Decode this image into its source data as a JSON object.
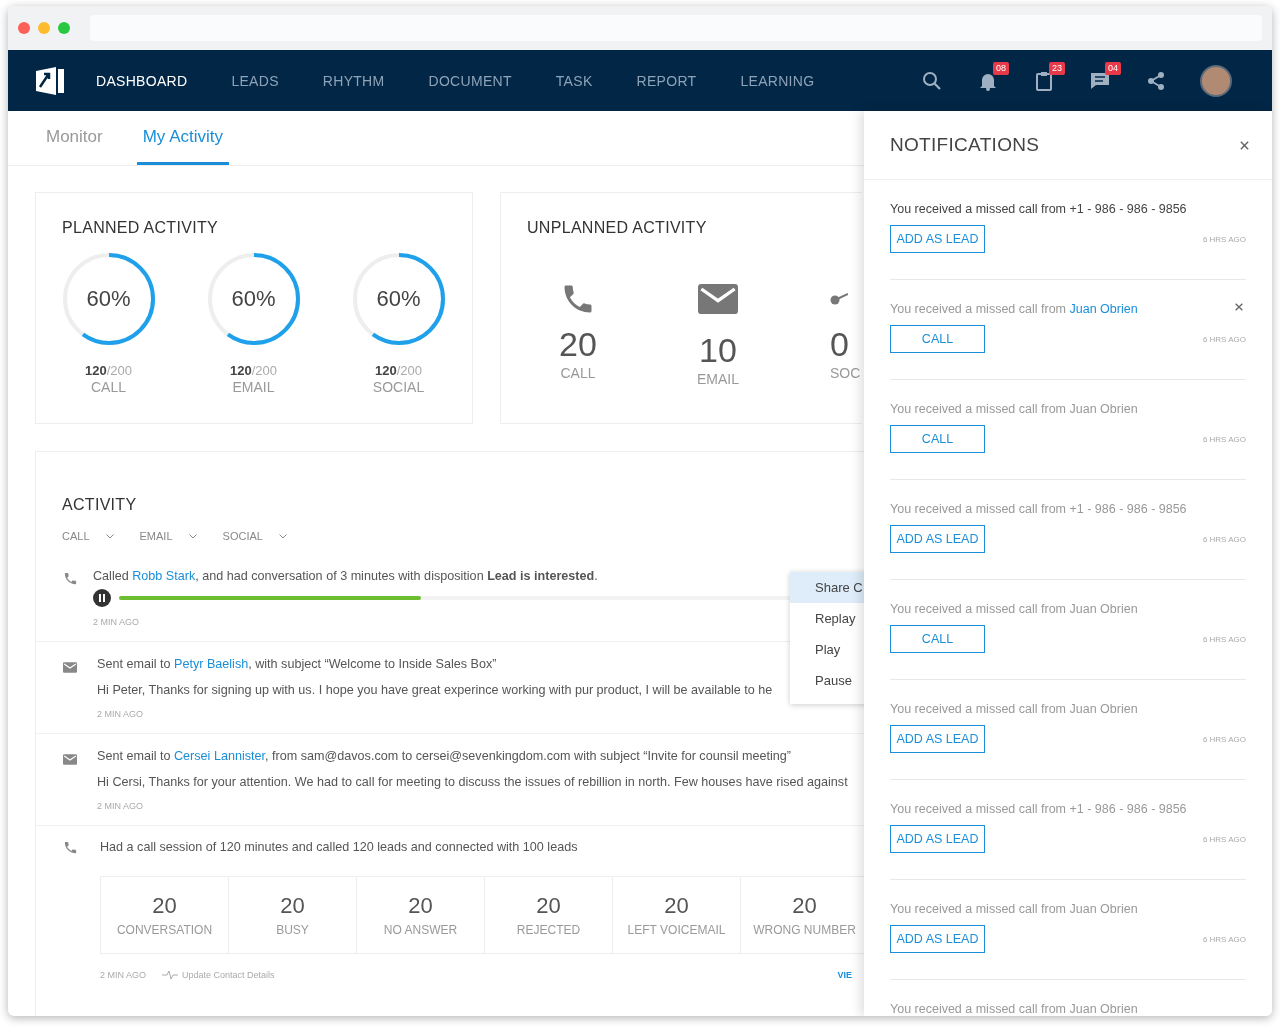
{
  "nav": {
    "items": [
      {
        "label": "DASHBOARD",
        "selected": true
      },
      {
        "label": "LEADS",
        "selected": false
      },
      {
        "label": "RHYTHM",
        "selected": false
      },
      {
        "label": "DOCUMENT",
        "selected": false
      },
      {
        "label": "TASK",
        "selected": false
      },
      {
        "label": "REPORT",
        "selected": false
      },
      {
        "label": "LEARNING",
        "selected": false
      }
    ],
    "icons": [
      {
        "kind": "search"
      },
      {
        "kind": "bell",
        "badge": "08"
      },
      {
        "kind": "clipboard",
        "badge": "23"
      },
      {
        "kind": "chat",
        "badge": "04"
      },
      {
        "kind": "share"
      },
      {
        "kind": "avatar"
      }
    ]
  },
  "tabs": [
    {
      "label": "Monitor",
      "selected": false
    },
    {
      "label": "My Activity",
      "selected": true
    }
  ],
  "planned": {
    "title": "PLANNED ACTIVITY",
    "items": [
      {
        "percent": "60%",
        "level": 0.6,
        "done": "120",
        "total": "/200",
        "label": "CALL"
      },
      {
        "percent": "60%",
        "level": 0.6,
        "done": "120",
        "total": "/200",
        "label": "EMAIL"
      },
      {
        "percent": "60%",
        "level": 0.6,
        "done": "120",
        "total": "/200",
        "label": "SOCIAL"
      }
    ]
  },
  "unplanned": {
    "title": "UNPLANNED ACTIVITY",
    "items": [
      {
        "kind": "phone",
        "count": "20",
        "label": "CALL"
      },
      {
        "kind": "email",
        "count": "10",
        "label": "EMAIL"
      },
      {
        "kind": "social",
        "count": "0",
        "label": "SOC"
      }
    ]
  },
  "activity": {
    "title": "ACTIVITY",
    "filters": [
      "CALL",
      "EMAIL",
      "SOCIAL"
    ],
    "rows": [
      {
        "kind": "call",
        "before": "Called ",
        "link": "Robb Stark",
        "after": ", and had conversation of 3 minutes with disposition **Lead is interested**.",
        "player": {
          "level": 0.45
        },
        "time": "2 MIN AGO"
      },
      {
        "kind": "email",
        "before": "Sent email to ",
        "link": "Petyr Baelish",
        "after": ", with subject “Welcome to Inside Sales Box”",
        "body": "Hi Peter, Thanks for signing up with us. I hope you have great experince working with pur product, I will be available to he",
        "time": "2 MIN AGO"
      },
      {
        "kind": "email",
        "before": "Sent email to ",
        "link": "Cersei Lannister",
        "after": ", from sam@davos.com to cersei@sevenkingdom.com with subject “Invite for counsil meeting”",
        "body": "Hi Cersi, Thanks for your attention. We had to call for meeting to discuss the issues of rebillion in north. Few houses have rised against",
        "time": "2 MIN AGO"
      },
      {
        "kind": "session",
        "text": "Had a call session of 120 minutes and called 120 leads and connected with 100 leads",
        "stats": [
          {
            "value": "20",
            "label": "CONVERSATION"
          },
          {
            "value": "20",
            "label": "BUSY"
          },
          {
            "value": "20",
            "label": "NO ANSWER"
          },
          {
            "value": "20",
            "label": "REJECTED"
          },
          {
            "value": "20",
            "label": "LEFT VOICEMAIL"
          },
          {
            "value": "20",
            "label": "WRONG NUMBER"
          }
        ],
        "time": "2 MIN AGO",
        "action": "Update Contact Details",
        "link_label": "VIE"
      }
    ],
    "menu": [
      {
        "label": "Share C",
        "selected": true
      },
      {
        "label": "Replay",
        "selected": false
      },
      {
        "label": "Play",
        "selected": false
      },
      {
        "label": "Pause",
        "selected": false
      }
    ]
  },
  "notifications": {
    "title": "NOTIFICATIONS",
    "items": [
      {
        "unread": true,
        "text": "You received a missed call from +1 - 986 - 986 - 9856",
        "button": "ADD AS LEAD",
        "time": "6 HRS AGO",
        "closable": false
      },
      {
        "unread": false,
        "text": "You received a missed call from ",
        "link": "Juan Obrien",
        "button": "CALL",
        "time": "6 HRS AGO",
        "closable": true
      },
      {
        "unread": false,
        "text": "You received a missed call from Juan Obrien",
        "button": "CALL",
        "time": "6 HRS AGO",
        "closable": false
      },
      {
        "unread": false,
        "text": "You received a missed call from +1 - 986 - 986 - 9856",
        "button": "ADD AS LEAD",
        "time": "6 HRS AGO",
        "closable": false
      },
      {
        "unread": false,
        "text": "You received a missed call from Juan Obrien",
        "button": "CALL",
        "time": "6 HRS AGO",
        "closable": false
      },
      {
        "unread": false,
        "text": "You received a missed call from Juan Obrien",
        "button": "ADD AS LEAD",
        "time": "6 HRS AGO",
        "closable": false
      },
      {
        "unread": false,
        "text": "You received a missed call from +1 - 986 - 986 - 9856",
        "button": "ADD AS LEAD",
        "time": "6 HRS AGO",
        "closable": false
      },
      {
        "unread": false,
        "text": "You received a missed call from Juan Obrien",
        "button": "ADD AS LEAD",
        "time": "6 HRS AGO",
        "closable": false
      },
      {
        "unread": false,
        "text": "You received a missed call from Juan Obrien",
        "closable": false
      }
    ]
  }
}
